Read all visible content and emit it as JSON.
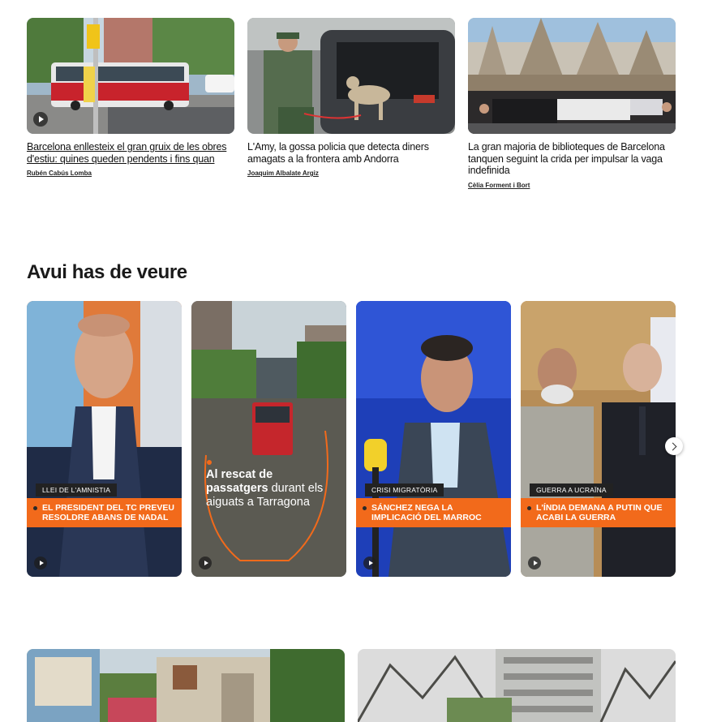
{
  "top_news": [
    {
      "headline": "Barcelona enllesteix el gran gruix de les obres d'estiu: quines queden pendents i fins quan",
      "author": "Rubén Cabús Lomba",
      "has_video": true
    },
    {
      "headline": "L'Amy, la gossa policia que detecta diners amagats a la frontera amb Andorra",
      "author": "Joaquim Albalate Argiz",
      "has_video": false
    },
    {
      "headline": "La gran majoria de biblioteques de Barcelona tanquen seguint la crida per impulsar la vaga indefinida",
      "author": "Cèlia Forment i Bort",
      "has_video": false
    }
  ],
  "section": {
    "title": "Avui has de veure"
  },
  "videos": [
    {
      "tag": "LLEI DE L'AMNISTIA",
      "headline": "EL PRESIDENT DEL TC PREVEU RESOLDRE ABANS DE NADAL"
    },
    {
      "overlay_bold": "Al rescat de passatgers",
      "overlay_rest": " durant els aiguats a Tarragona"
    },
    {
      "tag": "CRISI MIGRATÒRIA",
      "headline": "SÁNCHEZ NEGA LA IMPLICACIÓ DEL MARROC"
    },
    {
      "tag": "GUERRA A UCRAÏNA",
      "headline": "L'ÍNDIA DEMANA A PUTIN QUE ACABI LA GUERRA"
    }
  ],
  "icons": {
    "play": "play-icon",
    "next": "chevron-right-icon"
  },
  "colors": {
    "accent": "#f26a1b",
    "tag_bg": "#222222"
  }
}
